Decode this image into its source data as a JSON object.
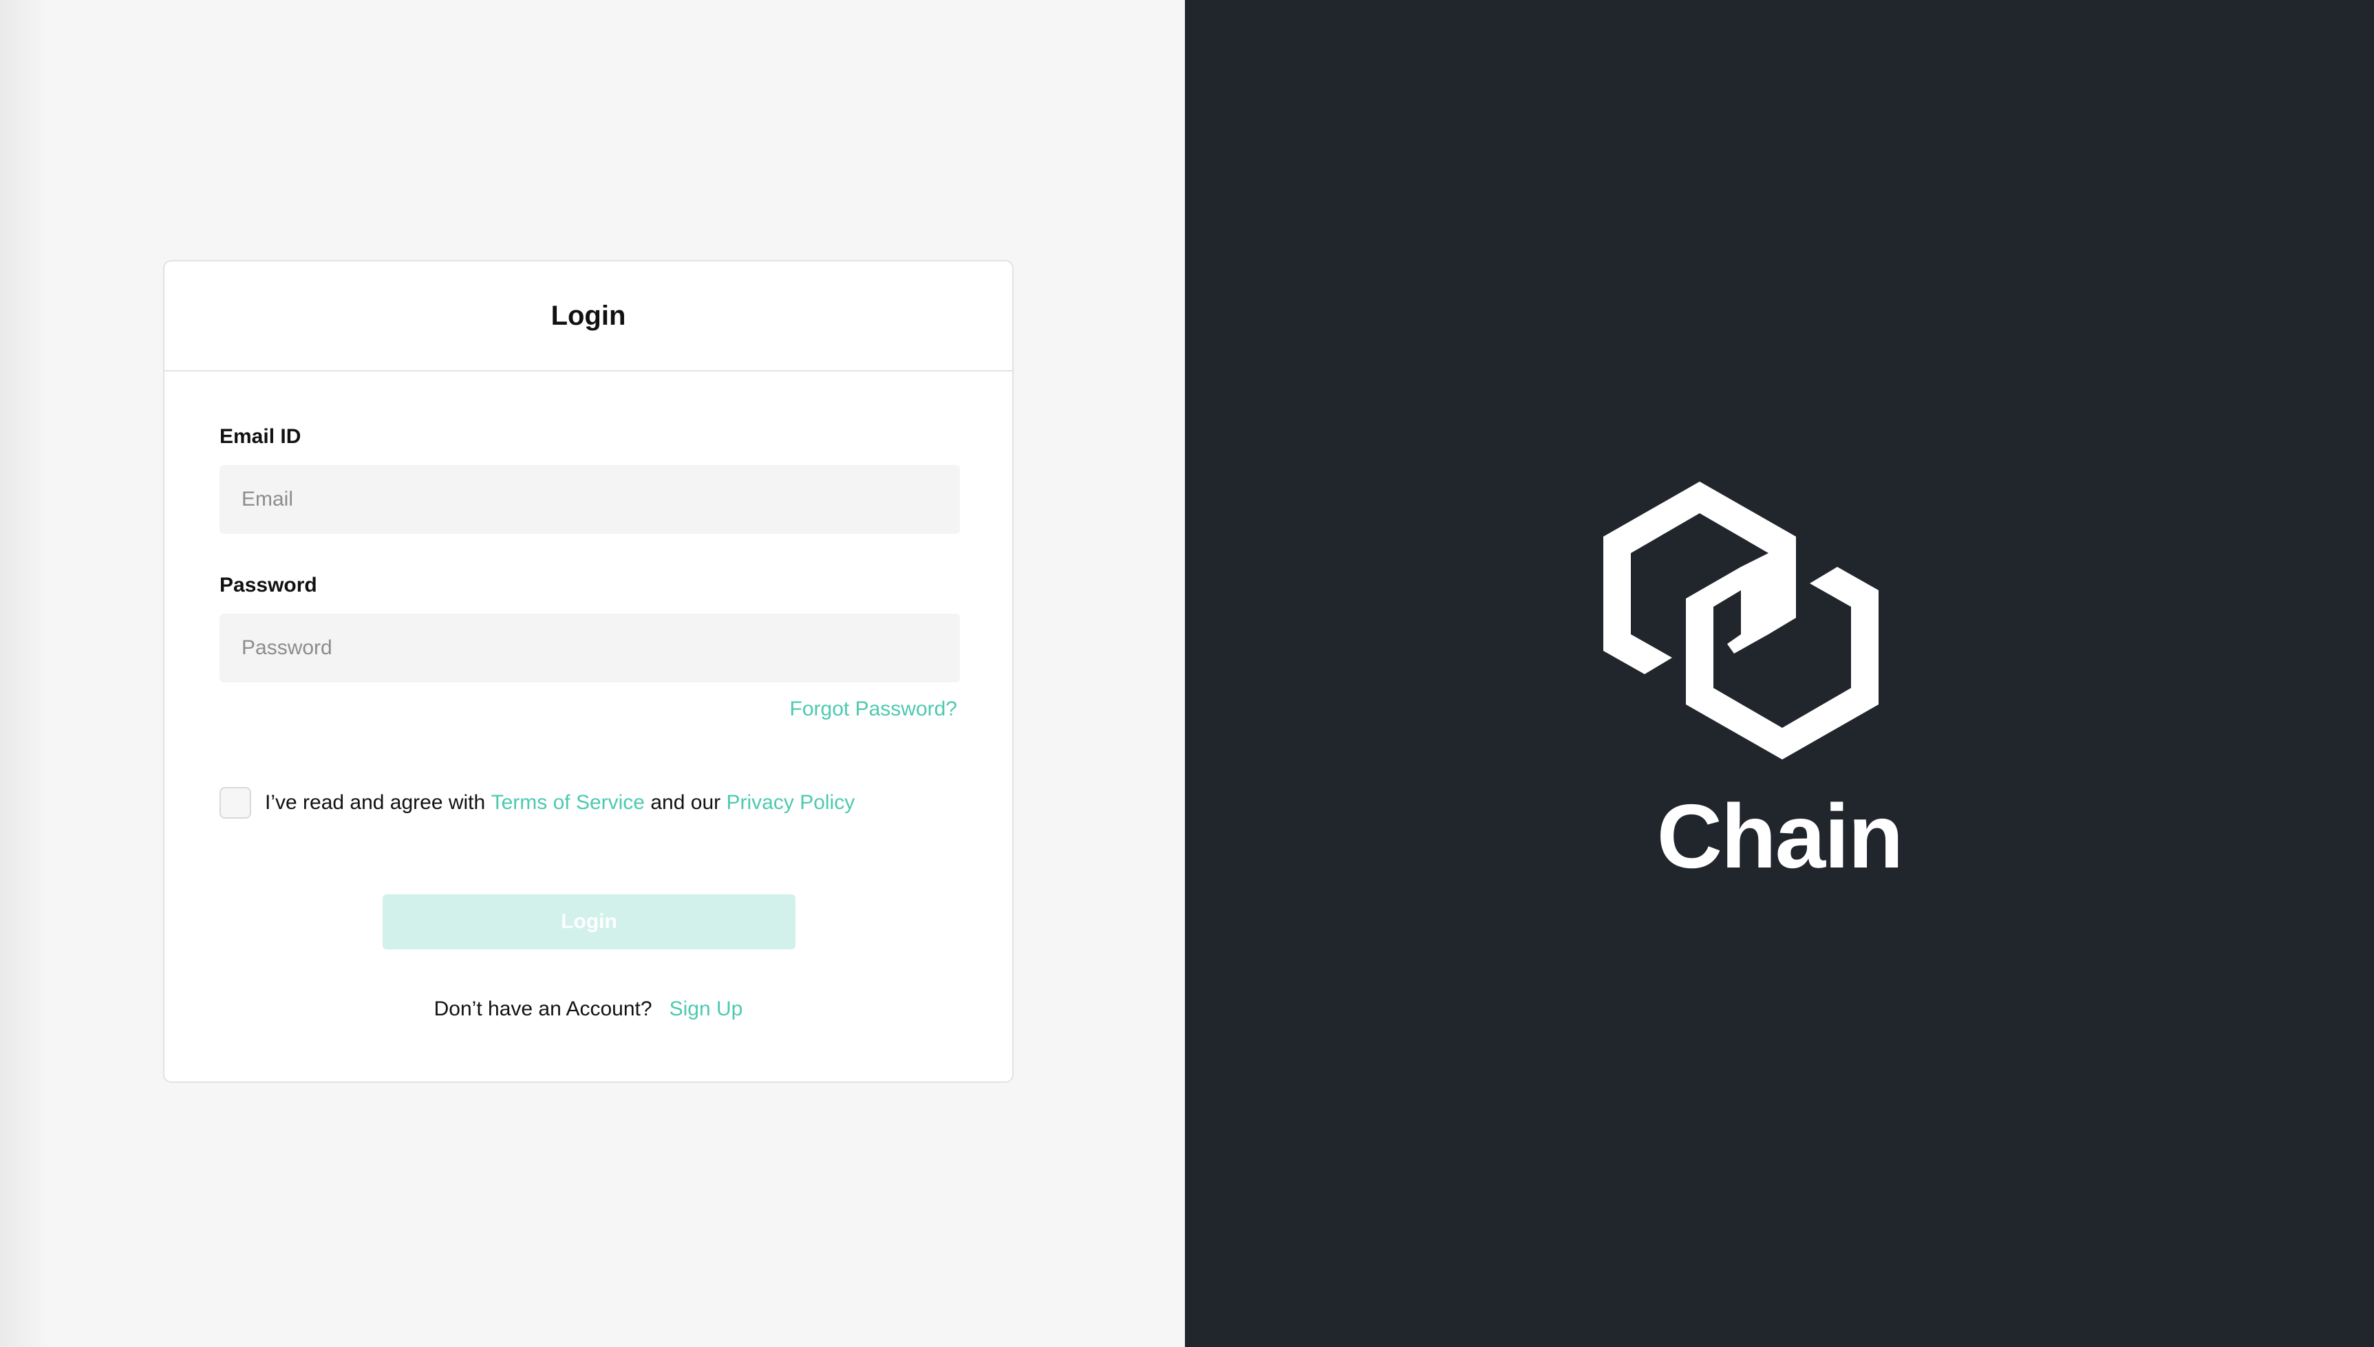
{
  "login_card": {
    "title": "Login",
    "email": {
      "label": "Email ID",
      "placeholder": "Email",
      "value": ""
    },
    "password": {
      "label": "Password",
      "placeholder": "Password",
      "value": ""
    },
    "forgot_password": "Forgot Password?",
    "agreement": {
      "checked": false,
      "prefix": "I’ve read and agree with",
      "terms_link": "Terms of Service",
      "middle": "and our",
      "privacy_link": "Privacy Policy"
    },
    "submit_label": "Login",
    "signup": {
      "prompt": "Don’t have an Account?",
      "link": "Sign Up"
    }
  },
  "brand": {
    "name": "Chain",
    "icon": "chain-logo-icon"
  },
  "colors": {
    "left_background": "#f6f6f6",
    "right_background": "#21252c",
    "accent": "#4ec9b0",
    "disabled_button": "#d2f1eb"
  }
}
